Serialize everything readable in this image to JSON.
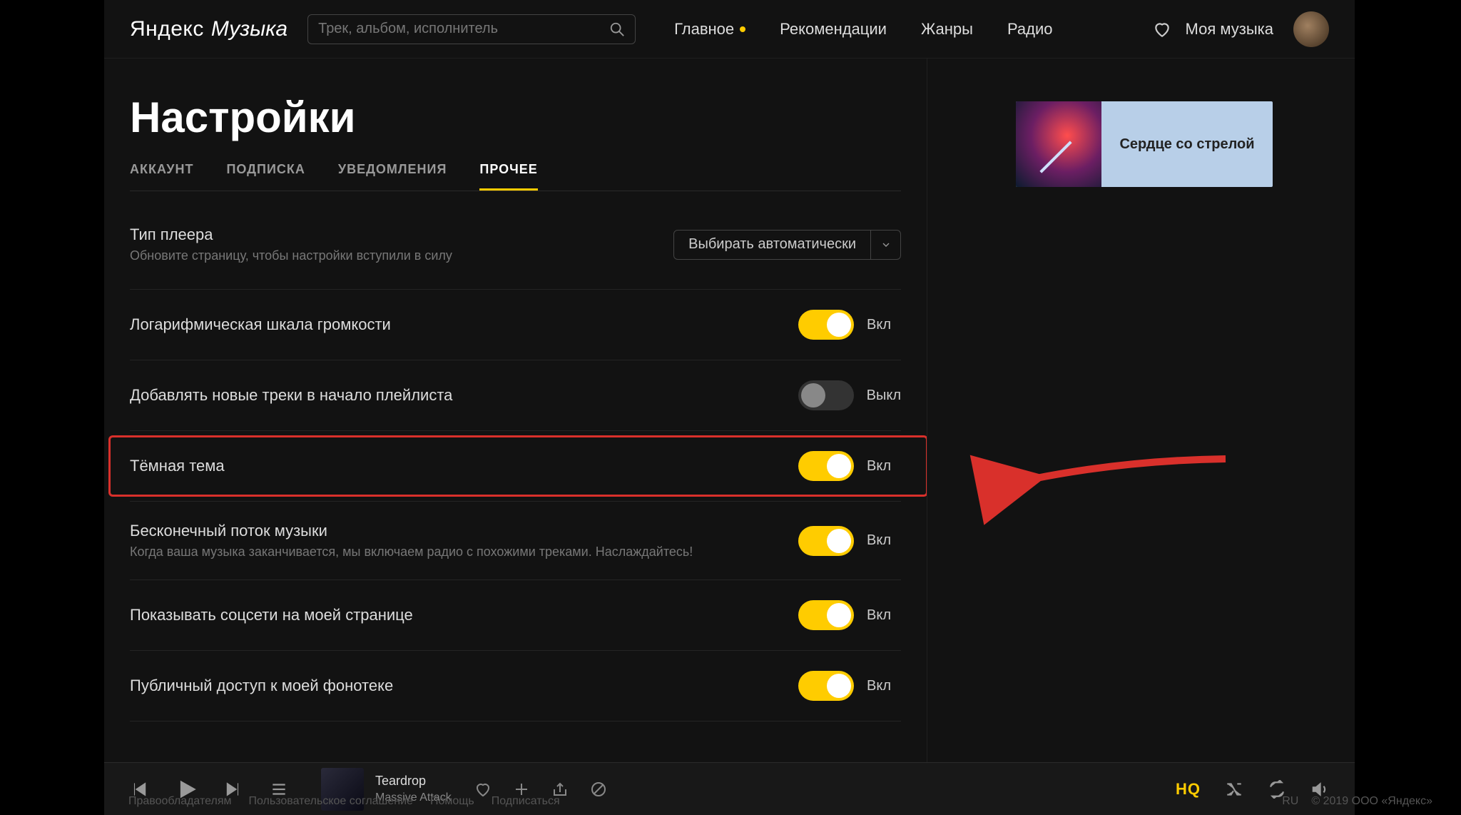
{
  "header": {
    "logo_yandex": "Яндекс",
    "logo_music": "Музыка",
    "search_placeholder": "Трек, альбом, исполнитель",
    "nav": {
      "main": "Главное",
      "recs": "Рекомендации",
      "genres": "Жанры",
      "radio": "Радио"
    },
    "my_music": "Моя музыка"
  },
  "page": {
    "title": "Настройки",
    "tabs": {
      "account": "АККАУНТ",
      "subscription": "ПОДПИСКА",
      "notifications": "УВЕДОМЛЕНИЯ",
      "other": "ПРОЧЕЕ"
    }
  },
  "settings": {
    "player_type": {
      "title": "Тип плеера",
      "sub": "Обновите страницу, чтобы настройки вступили в силу",
      "select_value": "Выбирать автоматически"
    },
    "log_scale": {
      "title": "Логарифмическая шкала громкости",
      "state": "Вкл"
    },
    "prepend": {
      "title": "Добавлять новые треки в начало плейлиста",
      "state": "Выкл"
    },
    "dark_theme": {
      "title": "Тёмная тема",
      "state": "Вкл"
    },
    "infinite": {
      "title": "Бесконечный поток музыки",
      "sub": "Когда ваша музыка заканчивается, мы включаем радио с похожими треками. Наслаждайтесь!",
      "state": "Вкл"
    },
    "social": {
      "title": "Показывать соцсети на моей странице",
      "state": "Вкл"
    },
    "public": {
      "title": "Публичный доступ к моей фонотеке",
      "state": "Вкл"
    }
  },
  "promo": {
    "text": "Сердце со стрелой"
  },
  "player": {
    "track_title": "Teardrop",
    "track_artist": "Massive Attack",
    "hq": "HQ"
  },
  "footer": {
    "rights": "Правообладателям",
    "agreement": "Пользовательское соглашение",
    "help": "Помощь",
    "subscribe": "Подписаться",
    "lang": "RU",
    "copyright": "© 2019 ООО «Яндекс»"
  }
}
